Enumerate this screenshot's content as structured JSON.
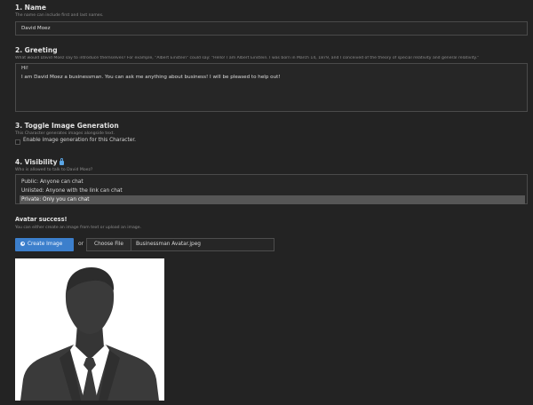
{
  "name": {
    "title": "1. Name",
    "hint": "The name can include first and last names.",
    "value": "David Moez"
  },
  "greeting": {
    "title": "2. Greeting",
    "hint": "What would David Moez say to introduce themselves? For example, \"Albert Einstein\" could say: \"Hello! I am Albert Einstein. I was born in March 14, 1879, and I conceived of the theory of special relativity and general relativity.\"",
    "line1": "Hi!",
    "line2": "I am David Moez a businessman. You can ask me anything about business! I will be pleased to help out!"
  },
  "image_generation": {
    "title": "3. Toggle Image Generation",
    "hint": "This Character generates images alongside text.",
    "checkbox_label": "Enable image generation for this Character."
  },
  "visibility": {
    "title": "4. Visibility",
    "hint": "Who is allowed to talk to David Moez?",
    "options": [
      "Public: Anyone can chat",
      "Unlisted: Anyone with the link can chat",
      "Private: Only you can chat"
    ],
    "selected_index": 2
  },
  "avatar": {
    "status": "Avatar success!",
    "hint": "You can either create an image from text or upload an image.",
    "create_label": "Create Image",
    "or_label": "or",
    "choose_label": "Choose File",
    "file_name": "Businessman Avatar.jpeg"
  },
  "colors": {
    "background": "#232323",
    "accent": "#3c7fcc",
    "selected_option": "#565656"
  },
  "icons": {
    "visibility": "lock-icon",
    "create": "create-image-icon",
    "avatar": "businessman-silhouette"
  }
}
